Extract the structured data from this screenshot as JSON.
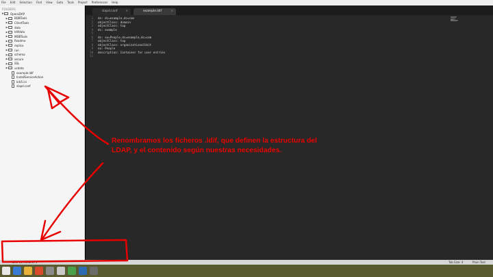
{
  "menubar": {
    "items": [
      "File",
      "Edit",
      "Selection",
      "Find",
      "View",
      "Goto",
      "Tools",
      "Project",
      "Preferences",
      "Help"
    ]
  },
  "sidebar": {
    "header": "FOLDERS",
    "root": "OpenLDAP",
    "folders": [
      "BDBTools",
      "ClientTools",
      "data",
      "ldifdata",
      "MDBTools",
      "Readme",
      "replica",
      "run",
      "schema",
      "secure",
      "SSL",
      "ucdata"
    ],
    "files": [
      "example.ldif",
      "InstallServiceAction",
      "krb5.ini",
      "slapd.conf"
    ]
  },
  "tabs": [
    {
      "label": "slapd.conf",
      "close": "×"
    },
    {
      "label": "example.ldif",
      "close": "×"
    }
  ],
  "editor": {
    "lines": [
      "dn: dc=example,dc=com",
      "objectClass: domain",
      "objectClass: top",
      "dc: example",
      "",
      "dn: ou=People,dc=example,dc=com",
      "objectClass: top",
      "objectClass: organizationalUnit",
      "ou: People",
      "description: Container for user entries",
      ""
    ],
    "line_numbers": [
      "1",
      "2",
      "3",
      "4",
      "5",
      "6",
      "7",
      "8",
      "9",
      "10",
      "11"
    ]
  },
  "annotation": {
    "text": "Renombramos los ficheros .ldif, que definen la estructura del LDAP, y el contenido según nuestras necesidades.",
    "color": "#e80000"
  },
  "statusbar": {
    "left": "Line 11, Column 1",
    "tab_size": "Tab Size: 4",
    "syntax": "Plain Text"
  },
  "colors": {
    "editor_bg": "#282828",
    "sidebar_bg": "#f5f5f5",
    "taskbar_bg": "#5a5a30",
    "annotation": "#e80000"
  }
}
